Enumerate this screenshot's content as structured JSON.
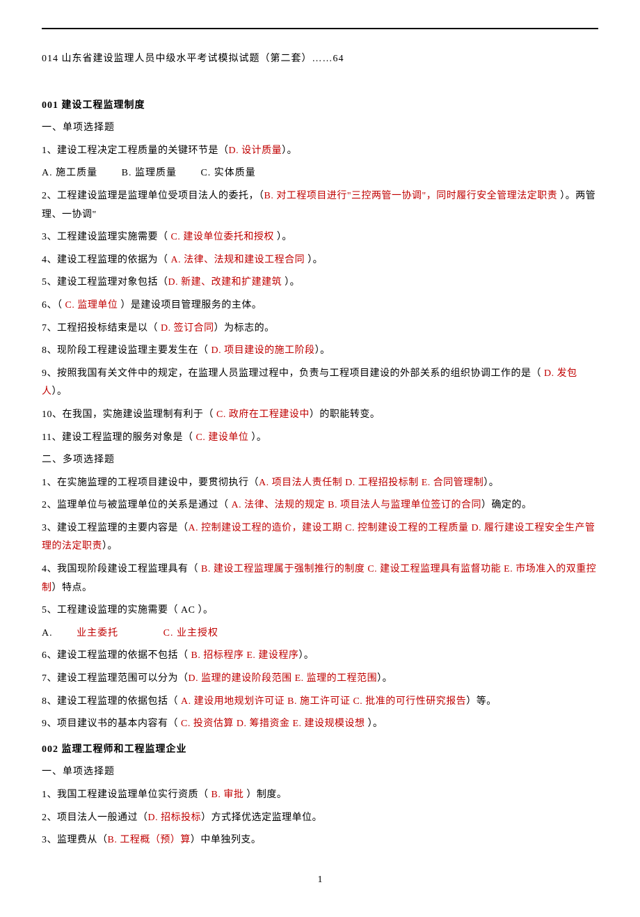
{
  "header_line": "014 山东省建设监理人员中级水平考试模拟试题（第二套）……64",
  "section1": {
    "title": "001 建设工程监理制度",
    "sub1": "一、单项选择题",
    "q1_a": "1、建设工程决定工程质量的关键环节是（",
    "q1_red": "D. 设计质量",
    "q1_b": "）。",
    "q1_options_a": "A. 施工质量",
    "q1_options_b": "B. 监理质量",
    "q1_options_c": "C. 实体质量",
    "q2_a": "2、工程建设监理是监理单位受项目法人的委托，（",
    "q2_red": "B. 对工程项目进行\"三控两管一协调\"，同时履行安全管理法定职责",
    "q2_b": "  ）。两管理、一协调\"",
    "q3_a": "3、工程建设监理实施需要（   ",
    "q3_red": "C. 建设单位委托和授权",
    "q3_b": "  ）。",
    "q4_a": "4、建设工程监理的依据为（   ",
    "q4_red": "A. 法律、法规和建设工程合同",
    "q4_b": "  ）。",
    "q5_a": "5、建设工程监理对象包括（",
    "q5_red": "D. 新建、改建和扩建建筑",
    "q5_b": "  ）。",
    "q6_a": "6、（   ",
    "q6_red": "C. 监理单位",
    "q6_b": "   ）是建设项目管理服务的主体。",
    "q7_a": "7、工程招投标结束是以（   ",
    "q7_red": "D. 签订合同",
    "q7_b": "）为标志的。",
    "q8_a": "8、现阶段工程建设监理主要发生在（   ",
    "q8_red": "D. 项目建设的施工阶段",
    "q8_b": "）。",
    "q9_a": "9、按照我国有关文件中的规定，在监理人员监理过程中，负责与工程项目建设的外部关系的组织协调工作的是（     ",
    "q9_red": "D. 发包人",
    "q9_b": "）。",
    "q10_a": "10、在我国，实施建设监理制有利于（   ",
    "q10_red": "C. 政府在工程建设中",
    "q10_b": "）的职能转变。",
    "q11_a": "11、建设工程监理的服务对象是（     ",
    "q11_red": "C. 建设单位",
    "q11_b": "  ）。",
    "sub2": "二、多项选择题",
    "mq1_a": "1、在实施监理的工程项目建设中，要贯彻执行（",
    "mq1_red": "A. 项目法人责任制   D. 工程招投标制 E. 合同管理制",
    "mq1_b": "）。",
    "mq2_a": "2、监理单位与被监理单位的关系是通过（ ",
    "mq2_red": "A. 法律、法规的规定 B. 项目法人与监理单位签订的合同",
    "mq2_b": "）确定的。",
    "mq3_a": "3、建设工程监理的主要内容是（",
    "mq3_red": "A. 控制建设工程的造价，建设工期     C. 控制建设工程的工程质量  D. 履行建设工程安全生产管理的法定职责",
    "mq3_b": "）。",
    "mq4_a": "4、我国现阶段建设工程监理具有（   ",
    "mq4_red": "B. 建设工程监理属于强制推行的制度  C. 建设工程监理具有监督功能     E. 市场准入的双重控制",
    "mq4_b": "）特点。",
    "mq5_a": "5、工程建设监理的实施需要（  AC  ）。",
    "mq5_opt_a": "A. ",
    "mq5_opt_a_red": "业主委托",
    "mq5_opt_c_red": "C. 业主授权",
    "mq6_a": "6、建设工程监理的依据不包括（     ",
    "mq6_red": "B. 招标程序     E. 建设程序",
    "mq6_b": "）。",
    "mq7_a": "7、建设工程监理范围可以分为（",
    "mq7_red": "D. 监理的建设阶段范围           E. 监理的工程范围",
    "mq7_b": "）。",
    "mq8_a": "8、建设工程监理的依据包括（   ",
    "mq8_red": "A. 建设用地规划许可证     B. 施工许可证       C. 批准的可行性研究报告",
    "mq8_b": "）等。",
    "mq9_a": "9、项目建议书的基本内容有（  ",
    "mq9_red": "C. 投资估算   D. 筹措资金   E. 建设规模设想",
    "mq9_b": "  ）。"
  },
  "section2": {
    "title": "002 监理工程师和工程监理企业",
    "sub1": "一、单项选择题",
    "q1_a": "1、我国工程建设监理单位实行资质（  ",
    "q1_red": "B. 审批",
    "q1_b": "   ）制度。",
    "q2_a": "2、项目法人一般通过（",
    "q2_red": "D. 招标投标",
    "q2_b": "）方式择优选定监理单位。",
    "q3_a": "3、监理费从（",
    "q3_red": "B. 工程概（预）算",
    "q3_b": "）中单独列支。"
  },
  "page_number": "1"
}
